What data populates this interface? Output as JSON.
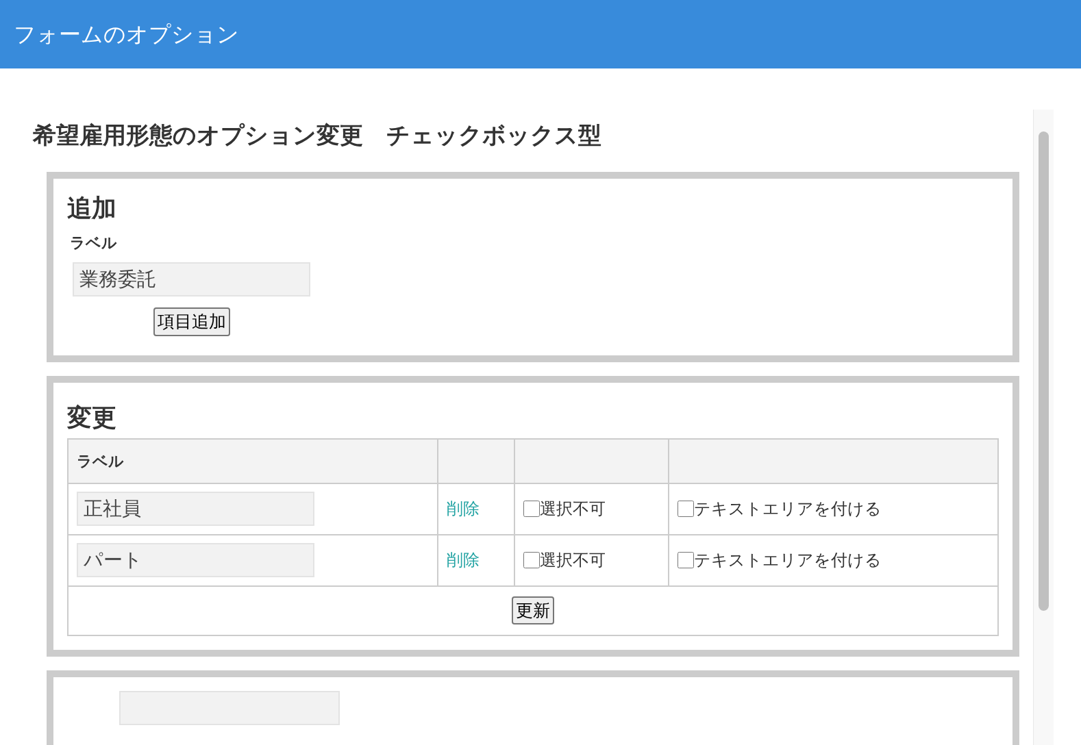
{
  "header": {
    "title": "フォームのオプション"
  },
  "page_title": "希望雇用形態のオプション変更　チェックボックス型",
  "add_section": {
    "heading": "追加",
    "label": "ラベル",
    "field": {
      "value": "業務委託"
    },
    "button": "項目追加"
  },
  "edit_section": {
    "heading": "変更",
    "columns": [
      "ラベル"
    ],
    "rows": [
      {
        "label": "正社員",
        "delete": "削除",
        "options": [
          {
            "kind": "checkbox",
            "text": "選択不可",
            "checked": false
          },
          {
            "kind": "checkbox",
            "text": "テキストエリアを付ける",
            "checked": false
          }
        ]
      },
      {
        "label": "パート",
        "delete": "削除",
        "options": [
          {
            "kind": "checkbox",
            "text": "選択不可",
            "checked": false
          },
          {
            "kind": "checkbox",
            "text": "テキストエリアを付ける",
            "checked": false
          }
        ]
      }
    ],
    "button": "更新"
  }
}
